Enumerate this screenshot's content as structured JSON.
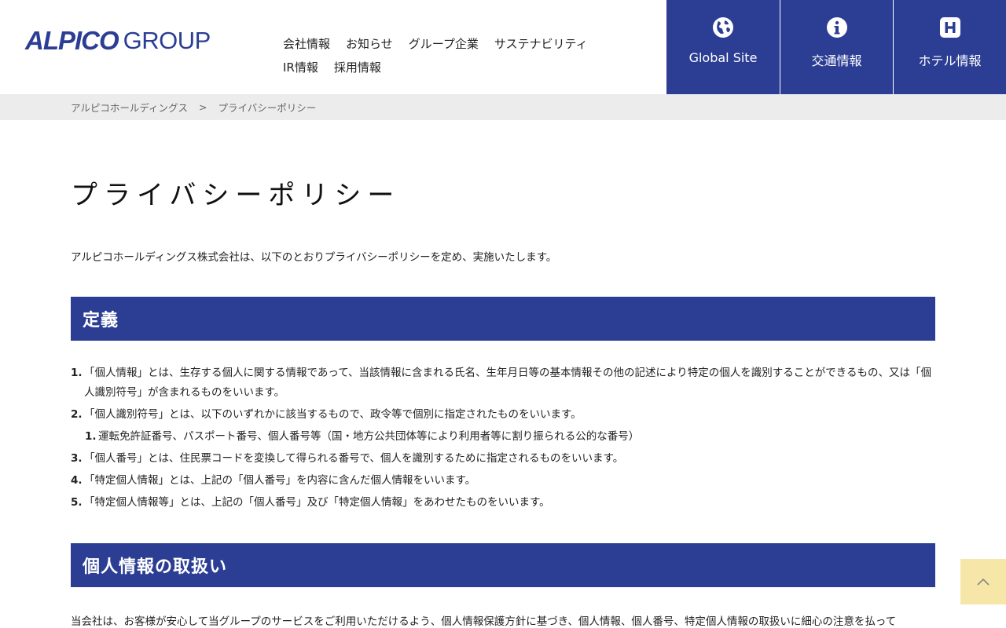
{
  "header": {
    "logo_mark": "ALPICO",
    "logo_group": "GROUP",
    "nav": [
      "会社情報",
      "お知らせ",
      "グループ企業",
      "サステナビリティ",
      "IR情報",
      "採用情報"
    ],
    "buttons": [
      {
        "label": "Global Site",
        "icon": "globe-icon"
      },
      {
        "label": "交通情報",
        "icon": "info-icon"
      },
      {
        "label": "ホテル情報",
        "icon": "hotel-icon"
      }
    ]
  },
  "breadcrumb": {
    "home": "アルピコホールディングス",
    "separator": ">",
    "current": "プライバシーポリシー"
  },
  "page": {
    "title": "プライバシーポリシー",
    "intro": "アルピコホールディングス株式会社は、以下のとおりプライバシーポリシーを定め、実施いたします。",
    "section1_title": "定義",
    "definitions": [
      {
        "num": "1.",
        "text": "「個人情報」とは、生存する個人に関する情報であって、当該情報に含まれる氏名、生年月日等の基本情報その他の記述により特定の個人を識別することができるもの、又は「個人識別符号」が含まれるものをいいます。"
      },
      {
        "num": "2.",
        "text": "「個人識別符号」とは、以下のいずれかに該当するもので、政令等で個別に指定されたものをいいます。"
      },
      {
        "num": "1.",
        "text": "運転免許証番号、パスポート番号、個人番号等（国・地方公共団体等により利用者等に割り振られる公的な番号）"
      },
      {
        "num": "3.",
        "text": "「個人番号」とは、住民票コードを変換して得られる番号で、個人を識別するために指定されるものをいいます。"
      },
      {
        "num": "4.",
        "text": "「特定個人情報」とは、上記の「個人番号」を内容に含んだ個人情報をいいます。"
      },
      {
        "num": "5.",
        "text": "「特定個人情報等」とは、上記の「個人番号」及び「特定個人情報」をあわせたものをいいます。"
      }
    ],
    "section2_title": "個人情報の取扱い",
    "section2_body": "当会社は、お客様が安心して当グループのサービスをご利用いただけるよう、個人情報保護方針に基づき、個人情報、個人番号、特定個人情報の取扱いに細心の注意を払って"
  },
  "colors": {
    "brand": "#2c3e94",
    "pagetop": "#f6e6a8",
    "breadcrumb_bg": "#ececec"
  }
}
